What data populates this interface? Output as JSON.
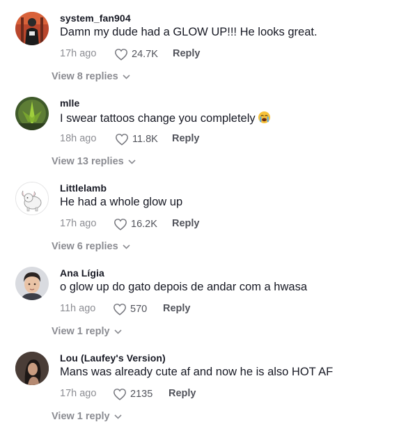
{
  "comments": [
    {
      "username": "system_fan904",
      "text": "Damn my dude had a GLOW UP!!! He looks great.",
      "time": "17h ago",
      "likes": "24.7K",
      "reply_label": "Reply",
      "view_replies": "View 8 replies",
      "emoji": ""
    },
    {
      "username": "mlle",
      "text": "I swear tattoos change you completely",
      "time": "18h ago",
      "likes": "11.8K",
      "reply_label": "Reply",
      "view_replies": "View 13 replies",
      "emoji": "loudly-crying-face"
    },
    {
      "username": "Littlelamb",
      "text": "He had a whole glow up",
      "time": "17h ago",
      "likes": "16.2K",
      "reply_label": "Reply",
      "view_replies": "View 6 replies",
      "emoji": ""
    },
    {
      "username": "Ana Lígia",
      "text": "o glow up do gato depois de andar com a hwasa",
      "time": "11h ago",
      "likes": "570",
      "reply_label": "Reply",
      "view_replies": "View 1 reply",
      "emoji": ""
    },
    {
      "username": "Lou (Laufey's Version)",
      "text": "Mans was already cute af and now he is also HOT AF",
      "time": "17h ago",
      "likes": "2135",
      "reply_label": "Reply",
      "view_replies": "View 1 reply",
      "emoji": ""
    }
  ],
  "colors": {
    "text_primary": "#161823",
    "text_secondary": "#8a8b91"
  }
}
